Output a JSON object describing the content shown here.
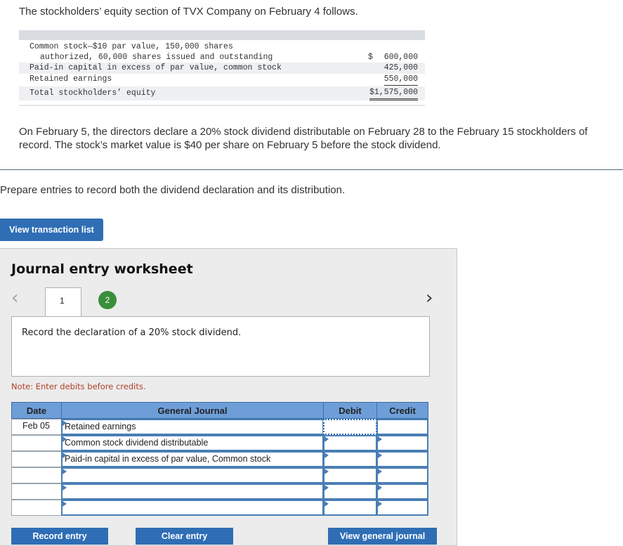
{
  "intro": "The stockholders’ equity section of TVX Company on February 4 follows.",
  "equity": {
    "rows": [
      {
        "label": "Common stock—$10 par value, 150,000 shares",
        "value": ""
      },
      {
        "label": "authorized, 60,000 shares issued and outstanding",
        "dollar": "$",
        "value": "600,000"
      },
      {
        "label": "Paid-in capital in excess of par value, common stock",
        "value": "425,000"
      },
      {
        "label": "Retained earnings",
        "value": "550,000"
      },
      {
        "label": "Total stockholders’ equity",
        "value": "$1,575,000"
      }
    ]
  },
  "paragraph": "On February 5, the directors declare a 20% stock dividend distributable on February 28 to the February 15 stockholders of record. The stock’s market value is $40 per share on February 5 before the stock dividend.",
  "prepare": "Prepare entries to record both the dividend declaration and its distribution.",
  "buttons": {
    "view_transaction_list": "View transaction list",
    "record_entry": "Record entry",
    "clear_entry": "Clear entry",
    "view_general_journal": "View general journal"
  },
  "worksheet": {
    "title": "Journal entry worksheet",
    "tabs": [
      "1",
      "2"
    ],
    "active_tab": "1",
    "description": "Record the declaration of a 20% stock dividend.",
    "note": "Note: Enter debits before credits.",
    "headers": {
      "date": "Date",
      "journal": "General Journal",
      "debit": "Debit",
      "credit": "Credit"
    },
    "rows": [
      {
        "date": "Feb 05",
        "account": "Retained earnings",
        "debit": "",
        "credit": ""
      },
      {
        "date": "",
        "account": "Common stock dividend distributable",
        "debit": "",
        "credit": ""
      },
      {
        "date": "",
        "account": "Paid-in capital in excess of par value, Common stock",
        "debit": "",
        "credit": ""
      },
      {
        "date": "",
        "account": "",
        "debit": "",
        "credit": ""
      },
      {
        "date": "",
        "account": "",
        "debit": "",
        "credit": ""
      },
      {
        "date": "",
        "account": "",
        "debit": "",
        "credit": ""
      }
    ]
  },
  "icons": {
    "prev": "chevron-left-icon",
    "next": "chevron-right-icon"
  },
  "colors": {
    "accent": "#2f6eb5",
    "header": "#6e9ed8",
    "tab2": "#3a8f3a",
    "note": "#b0402a"
  }
}
